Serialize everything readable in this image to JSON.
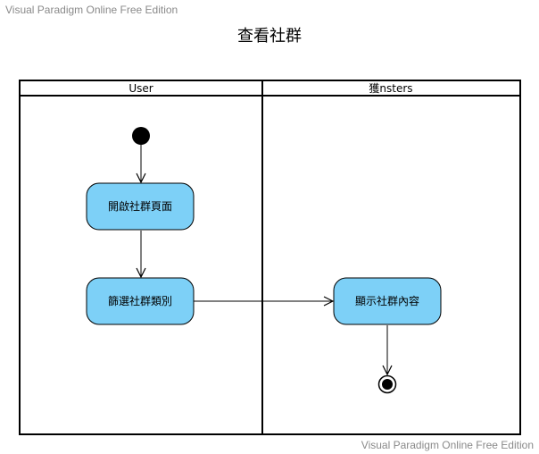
{
  "watermark": "Visual Paradigm Online Free Edition",
  "title": "查看社群",
  "lanes": [
    "User",
    "獲nsters"
  ],
  "actions": {
    "open_page": "開啟社群頁面",
    "filter_category": "篩選社群類別",
    "show_content": "顯示社群內容"
  },
  "colors": {
    "action_fill": "#7dd0f7",
    "stroke": "#000000",
    "watermark": "#8a8a8a"
  }
}
